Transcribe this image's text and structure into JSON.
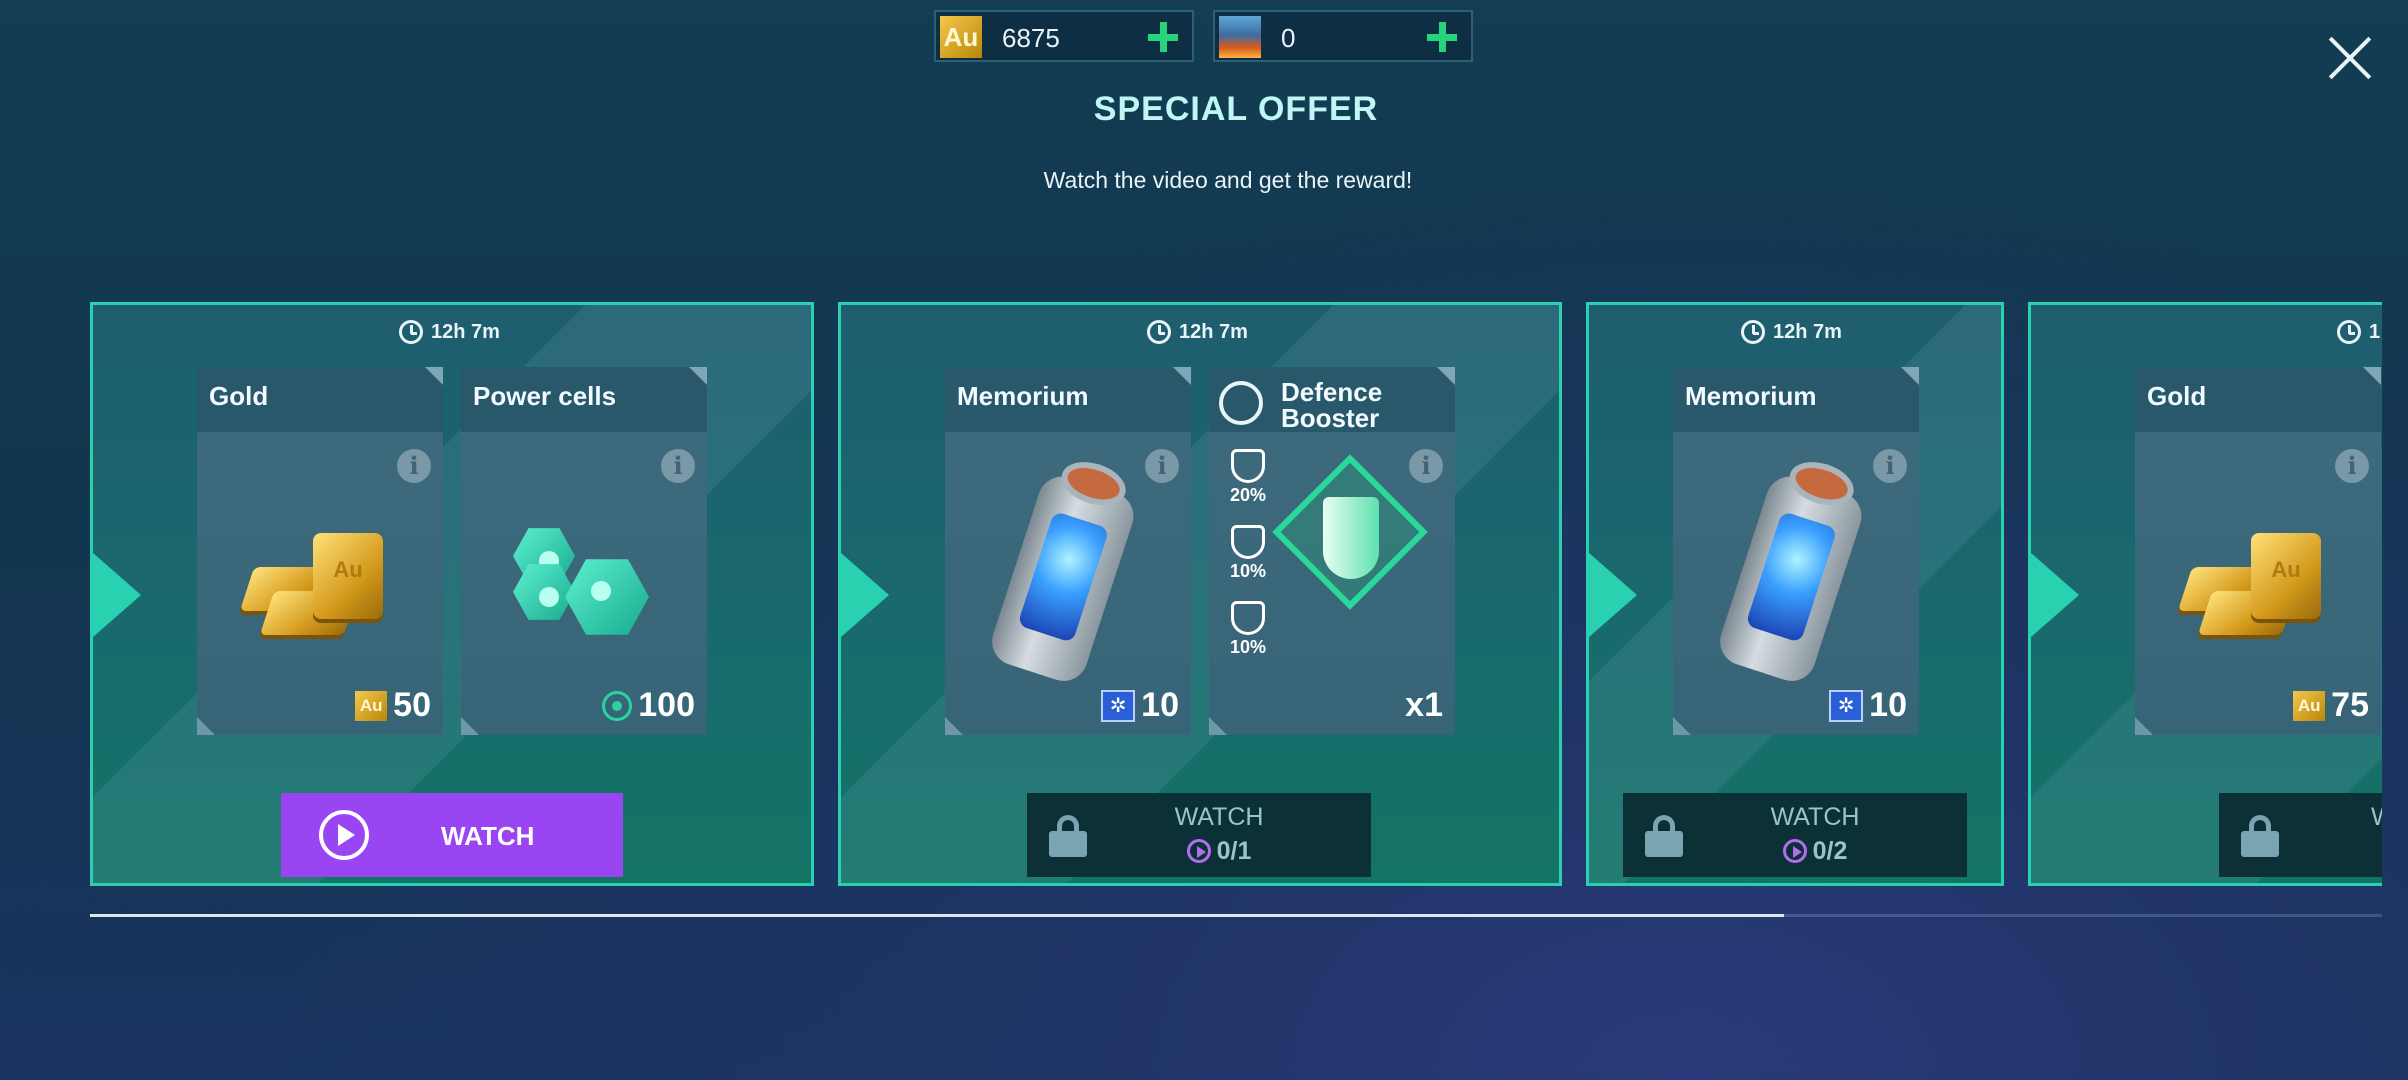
{
  "currency": {
    "gold": {
      "icon_label": "Au",
      "value": "6875"
    },
    "energy": {
      "value": "0"
    }
  },
  "header": {
    "title": "SPECIAL OFFER",
    "subtitle": "Watch the video and get the reward!"
  },
  "offers": [
    {
      "timer": "12h 7m",
      "items": [
        {
          "name": "Gold",
          "amount": "50",
          "currency_icon": "Au"
        },
        {
          "name": "Power cells",
          "amount": "100"
        }
      ],
      "button": {
        "label": "WATCH"
      }
    },
    {
      "timer": "12h 7m",
      "items": [
        {
          "name": "Memorium",
          "amount": "10"
        },
        {
          "name_line1": "Defence",
          "name_line2": "Booster",
          "amount": "x1",
          "stats": [
            "20%",
            "10%",
            "10%"
          ]
        }
      ],
      "button": {
        "label": "WATCH",
        "progress": "0/1"
      }
    },
    {
      "timer": "12h 7m",
      "items": [
        {
          "name": "Memorium",
          "amount": "10"
        }
      ],
      "button": {
        "label": "WATCH",
        "progress": "0/2"
      }
    },
    {
      "timer": "1",
      "items": [
        {
          "name": "Gold",
          "amount": "75",
          "currency_icon": "Au"
        }
      ],
      "button": {
        "label": "W"
      }
    }
  ],
  "info_symbol": "i",
  "scroll": {
    "position_fraction": 0.74
  }
}
